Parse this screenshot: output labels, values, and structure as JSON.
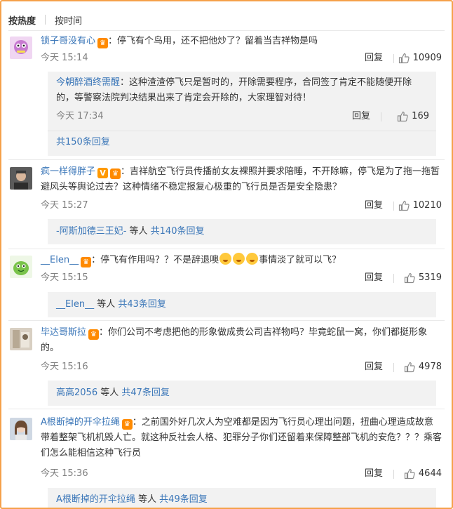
{
  "sort": {
    "hot": "按热度",
    "time": "按时间"
  },
  "comments": [
    {
      "user": "锁子哥没有心",
      "text": "：停飞有个鸟用，还不把他炒了？留着当吉祥物是吗",
      "time": "今天 15:14",
      "reply": "回复",
      "likes": "10909",
      "sub": {
        "user": "今朝醉酒终需醒",
        "text": "：这种渣渣停飞只是暂时的，开除需要程序，合同签了肯定不能随便开除的，等警察法院判决结果出来了肯定会开除的，大家理智对待！",
        "time": "今天 17:34",
        "reply": "回复",
        "likes": "169"
      },
      "more": "共150条回复"
    },
    {
      "user": "疯一样得胖子",
      "text": "：吉祥航空飞行员传播前女友裸照并要求陪睡，不开除嘛，停飞是为了拖一拖暂避风头等舆论过去？这种情绪不稳定报复心极重的飞行员是否是安全隐患？",
      "time": "今天 15:27",
      "reply": "回复",
      "likes": "10210",
      "more_user": "-阿斯加德三王妃-",
      "more_mid": " 等人 ",
      "more": "共140条回复"
    },
    {
      "user": "__Elen__",
      "text_before": "：停飞有作用吗？？不是辞退噢",
      "text_after": "事情淡了就可以飞？",
      "time": "今天 15:15",
      "reply": "回复",
      "likes": "5319",
      "more_user": "__Elen__",
      "more_mid": " 等人 ",
      "more": "共43条回复"
    },
    {
      "user": "毕达哥斯拉",
      "text": "：你们公司不考虑把他的形象做成贵公司吉祥物吗？毕竟蛇鼠一窝，你们都挺形象的。",
      "time": "今天 15:16",
      "reply": "回复",
      "likes": "4978",
      "more_user": "高高2056",
      "more_mid": " 等人 ",
      "more": "共47条回复"
    },
    {
      "user": "A根断掉的开伞拉绳",
      "text": "：之前国外好几次人为空难都是因为飞行员心理出问题，扭曲心理造成故意带着整架飞机机毁人亡。就这种反社会人格、犯罪分子你们还留着来保障整部飞机的安危？？？乘客们怎么能相信这种飞行员",
      "time": "今天 15:36",
      "reply": "回复",
      "likes": "4644",
      "more_user": "A根断掉的开伞拉绳",
      "more_mid": " 等人 ",
      "more": "共49条回复"
    }
  ],
  "colors": {
    "link": "#3a76b8",
    "border": "#f5a14a",
    "box": "#f2f2f2"
  }
}
